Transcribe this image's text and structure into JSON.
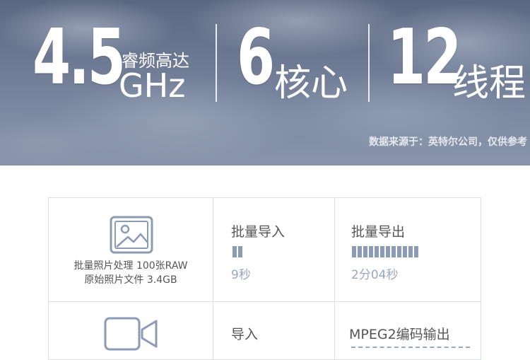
{
  "banner": {
    "freq_number": "4.5",
    "freq_label": "睿频高达",
    "freq_unit": "GHz",
    "cores_number": "6",
    "cores_label": "核心",
    "threads_number": "12",
    "threads_label": "线程",
    "source_note": "数据来源于：英特尔公司，仅供参考"
  },
  "table": {
    "row1": {
      "icon": "image-icon",
      "desc_line1": "批量照片处理 100张RAW",
      "desc_line2": "原始照片文件 3.4GB",
      "import_title": "批量导入",
      "import_time": "9秒",
      "import_progress_segments": 2,
      "export_title": "批量导出",
      "export_time": "2分04秒",
      "export_progress_segments": 12,
      "bar_color": "#8c9bb5"
    },
    "row2": {
      "icon": "video-camera-icon",
      "import_title": "导入",
      "export_title": "MPEG2编码输出"
    }
  }
}
